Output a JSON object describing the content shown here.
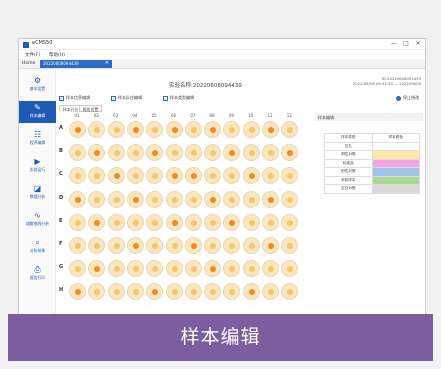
{
  "window": {
    "app_title": "eCMS50",
    "controls": [
      "—",
      "□",
      "✕"
    ]
  },
  "menu": [
    "文件(F)",
    "帮助(H)"
  ],
  "tabs": {
    "home": "Home",
    "active": "20220608094439",
    "close": "✕"
  },
  "sidebar": [
    {
      "label": "基本设置",
      "icon": "gear-icon",
      "glyph": "⚙"
    },
    {
      "label": "样本编辑",
      "icon": "document-edit-icon",
      "glyph": "✎"
    },
    {
      "label": "程序编辑",
      "icon": "program-list-icon",
      "glyph": "☷"
    },
    {
      "label": "实验运行",
      "icon": "run-icon",
      "glyph": "▶"
    },
    {
      "label": "数据分析",
      "icon": "chart-icon",
      "glyph": "◪"
    },
    {
      "label": "熔解曲线分析",
      "icon": "curve-icon",
      "glyph": "∿"
    },
    {
      "label": "分析结果",
      "icon": "magnifier-icon",
      "glyph": "⌕"
    },
    {
      "label": "报告打印",
      "icon": "printer-icon",
      "glyph": "⎙"
    }
  ],
  "experiment": {
    "title": "实验名称:20220608094439",
    "meta_line1": "ID:20220608094439",
    "meta_line2": "2022/06/08 09:45:39 — 2022/06/08"
  },
  "toolbar": {
    "checks": [
      "样本信息编辑",
      "样本反应编辑",
      "样本类型编辑"
    ],
    "stop_label": "停止修改"
  },
  "subtabs": [
    "样本孔位",
    "报告位置"
  ],
  "plate": {
    "columns": [
      "01",
      "02",
      "03",
      "04",
      "05",
      "06",
      "07",
      "08",
      "09",
      "10",
      "11",
      "12"
    ],
    "rows": [
      "A",
      "B",
      "C",
      "D",
      "E",
      "F",
      "G",
      "H"
    ],
    "sample_wells": [
      [
        1,
        0,
        0,
        1,
        0,
        1,
        0,
        1,
        0,
        0,
        1,
        0
      ],
      [
        0,
        1,
        0,
        0,
        1,
        0,
        0,
        0,
        1,
        0,
        0,
        1
      ],
      [
        0,
        0,
        1,
        0,
        0,
        1,
        1,
        0,
        0,
        1,
        0,
        0
      ],
      [
        1,
        0,
        0,
        1,
        0,
        0,
        0,
        1,
        0,
        0,
        1,
        0
      ],
      [
        0,
        1,
        0,
        0,
        0,
        1,
        0,
        0,
        1,
        0,
        0,
        0
      ],
      [
        0,
        0,
        0,
        1,
        0,
        0,
        1,
        0,
        0,
        0,
        1,
        0
      ],
      [
        0,
        1,
        0,
        0,
        0,
        0,
        0,
        1,
        0,
        0,
        0,
        0
      ],
      [
        1,
        0,
        0,
        0,
        1,
        0,
        0,
        0,
        0,
        1,
        0,
        0
      ]
    ]
  },
  "legend": {
    "title": "样本编辑",
    "col1": "样本类型",
    "col2": "样本颜色",
    "rows": [
      {
        "name": "空孔",
        "color": "#ffffff"
      },
      {
        "name": "阴性对照",
        "color": "#fde8a6"
      },
      {
        "name": "标准品",
        "color": "#f5a3e6"
      },
      {
        "name": "阳性对照",
        "color": "#9fc3ea"
      },
      {
        "name": "未知样本",
        "color": "#a8d88f"
      },
      {
        "name": "空白对照",
        "color": "#d9d9d9"
      }
    ]
  },
  "caption": "样本编辑"
}
